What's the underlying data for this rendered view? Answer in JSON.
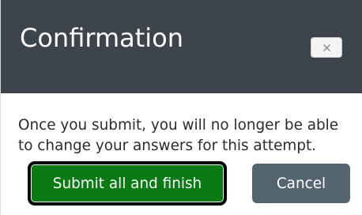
{
  "dialog": {
    "title": "Confirmation",
    "close_icon": "close-icon",
    "message_line1": "Once you submit, you will no longer be able",
    "message_line2": "to change your answers for this attempt.",
    "primary_button_label": "Submit all and finish",
    "secondary_button_label": "Cancel"
  },
  "colors": {
    "header_background": "#3d444b",
    "primary_button": "#0a7a15",
    "secondary_button": "#556570",
    "text": "#2b2b2b"
  }
}
